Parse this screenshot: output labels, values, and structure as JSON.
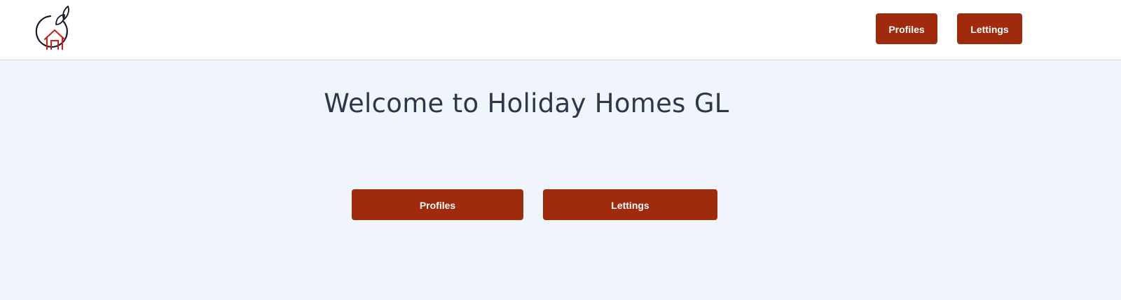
{
  "header": {
    "logo_icon": "orange-house-logo-icon",
    "nav": {
      "profiles_label": "Profiles",
      "lettings_label": "Lettings"
    }
  },
  "main": {
    "title": "Welcome to Holiday Homes GL",
    "buttons": {
      "profiles_label": "Profiles",
      "lettings_label": "Lettings"
    }
  },
  "colors": {
    "accent": "#a02a0c",
    "background": "#f0f4fb",
    "header_background": "#ffffff",
    "title_text": "#2c3847",
    "logo_outline": "#0e1a2b",
    "logo_house": "#c0281a"
  }
}
